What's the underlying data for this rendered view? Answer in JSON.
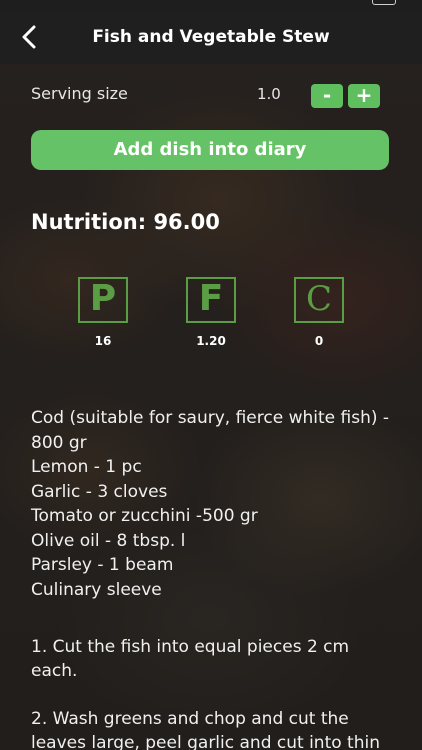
{
  "header": {
    "title": "Fish and Vegetable Stew",
    "back_icon": "chevron-left-icon"
  },
  "serving": {
    "label": "Serving size",
    "value": "1.0",
    "minus_label": "-",
    "plus_label": "+"
  },
  "add_button_label": "Add dish into diary",
  "nutrition": {
    "title": "Nutrition: 96.00",
    "macros": [
      {
        "letter": "P",
        "value": "16"
      },
      {
        "letter": "F",
        "value": "1.20"
      },
      {
        "letter": "C",
        "value": "0"
      }
    ]
  },
  "ingredients": [
    "Cod (suitable for saury, fierce white fish) - 800 gr",
    "Lemon - 1 pc",
    "Garlic - 3 cloves",
    "Tomato or zucchini -500 gr",
    "Olive oil - 8 tbsp. l",
    "Parsley - 1 beam",
    "Culinary sleeve"
  ],
  "steps": [
    "1. Cut the fish into equal pieces 2 cm each.",
    "2. Wash greens and chop and cut the leaves large, peel garlic and cut into thin"
  ],
  "colors": {
    "accent_green": "#66c267",
    "macro_green": "#5b9d45",
    "header_bg": "#1f1f1f"
  }
}
